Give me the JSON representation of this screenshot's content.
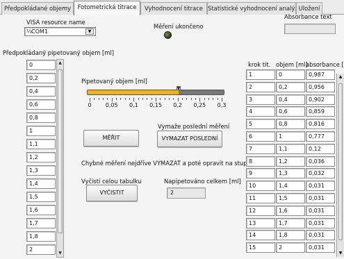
{
  "tabs": [
    {
      "label": "Předpokládané objemy",
      "active": false
    },
    {
      "label": "Fotometrická titrace",
      "active": true
    },
    {
      "label": "Vyhodnocení titrace",
      "active": false
    },
    {
      "label": "Statistické vyhodnocení analýzy",
      "active": false
    },
    {
      "label": "Uložení",
      "active": false
    }
  ],
  "visa": {
    "label": "VISA resource name",
    "value": "COM1",
    "icon": "io-resource-icon"
  },
  "measurement_done": {
    "label": "Měření ukončeno",
    "led_color": "#3f4a25"
  },
  "absorbance_text": {
    "label": "Absorbance text",
    "value": ""
  },
  "predicted_volumes": {
    "label": "Předpokládaný pipetovaný objem [ml]",
    "values": [
      "0",
      "0,2",
      "0,4",
      "0,6",
      "0,8",
      "1",
      "1,1",
      "1,2",
      "1,3",
      "1,4",
      "1,5",
      "1,6",
      "1,7",
      "1,8",
      "2"
    ]
  },
  "pipetted_volume": {
    "label": "Pipetovaný objem [ml]",
    "value": 0.2,
    "min": 0,
    "max": 0.3,
    "ticks": [
      "0",
      "0,05",
      "0,1",
      "0,15",
      "0,2",
      "0,25",
      "0,3"
    ],
    "fill_color": "#f0b020"
  },
  "measure_button": {
    "label": "MĚŘIT"
  },
  "delete_last": {
    "hint": "Vymaže poslední měření",
    "label": "VYMAZAT POSLEDNÍ"
  },
  "error_hint": "Chybné měření nejdříve VYMAZAT a poté opravit na stupnici",
  "clear_table": {
    "hint": "Vyčistí celou tabulku",
    "label": "VYČISTIT"
  },
  "total_pipetted": {
    "label": "Napipetováno celkem [ml]",
    "value": "2"
  },
  "table": {
    "headers": [
      "krok tit.",
      "objem [ml]",
      "absorbance [-"
    ],
    "rows": [
      [
        "1",
        "0",
        "0,987"
      ],
      [
        "2",
        "0,2",
        "0,956"
      ],
      [
        "3",
        "0,4",
        "0,902"
      ],
      [
        "4",
        "0,6",
        "0,859"
      ],
      [
        "5",
        "0,8",
        "0,816"
      ],
      [
        "6",
        "1",
        "0,777"
      ],
      [
        "7",
        "1,1",
        "0,12"
      ],
      [
        "8",
        "1,2",
        "0,036"
      ],
      [
        "9",
        "1,3",
        "0,032"
      ],
      [
        "10",
        "1,4",
        "0,031"
      ],
      [
        "11",
        "1,5",
        "0,031"
      ],
      [
        "12",
        "1,6",
        "0,031"
      ],
      [
        "13",
        "1,7",
        "0,031"
      ],
      [
        "14",
        "1,8",
        "0,031"
      ],
      [
        "15",
        "2",
        "0,031"
      ]
    ]
  }
}
